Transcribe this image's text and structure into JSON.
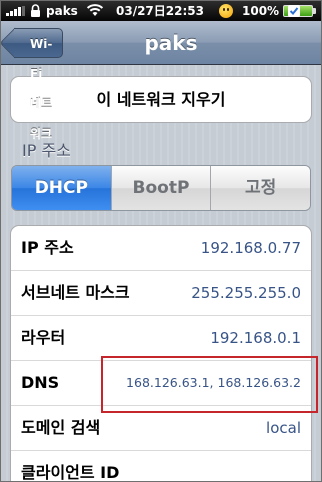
{
  "status_bar": {
    "carrier": "paks",
    "time": "03/27日22:53",
    "battery": "100%"
  },
  "nav": {
    "back_label": "Wi-Fi 네트워크",
    "title": "paks"
  },
  "forget_button": "이 네트워크 지우기",
  "section_label": "IP 주소",
  "segments": [
    {
      "label": "DHCP",
      "selected": true
    },
    {
      "label": "BootP",
      "selected": false
    },
    {
      "label": "고정",
      "selected": false
    }
  ],
  "rows": [
    {
      "label": "IP 주소",
      "value": "192.168.0.77"
    },
    {
      "label": "서브네트 마스크",
      "value": "255.255.255.0"
    },
    {
      "label": "라우터",
      "value": "192.168.0.1"
    },
    {
      "label": "DNS",
      "value": "168.126.63.1, 168.126.63.2"
    },
    {
      "label": "도메인 검색",
      "value": "local"
    },
    {
      "label": "클라이언트 ID",
      "value": ""
    }
  ],
  "highlight_color": "#c4262c",
  "selected_segment_color": "#2f7ce0"
}
